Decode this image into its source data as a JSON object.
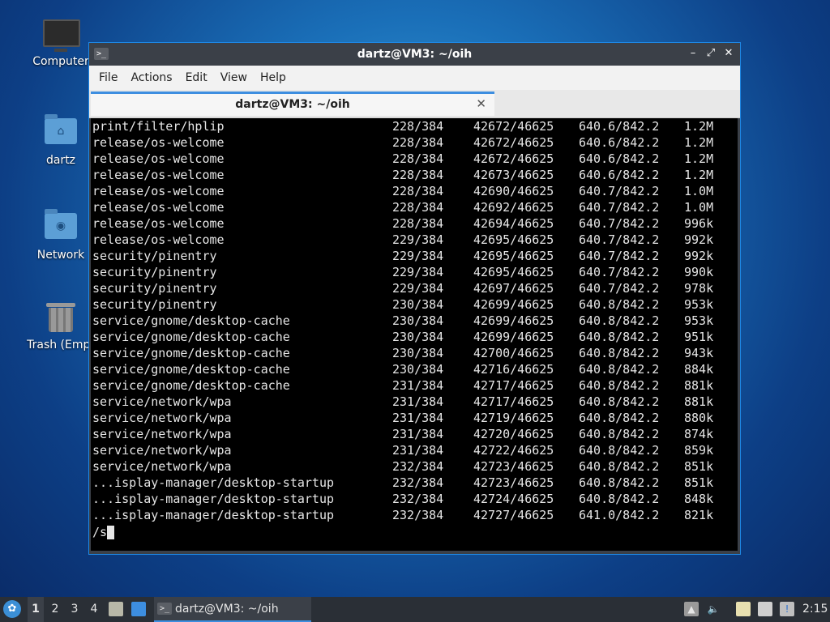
{
  "desktop": {
    "icons": [
      {
        "label": "Computer"
      },
      {
        "label": "dartz"
      },
      {
        "label": "Network"
      },
      {
        "label": "Trash (Empt"
      }
    ]
  },
  "window": {
    "title": "dartz@VM3: ~/oih",
    "controls": {
      "minimize": "–",
      "maximize": "⤢",
      "close": "✕"
    },
    "menu": [
      "File",
      "Actions",
      "Edit",
      "View",
      "Help"
    ],
    "tab": {
      "title": "dartz@VM3: ~/oih",
      "close": "✕"
    }
  },
  "terminal": {
    "rows": [
      [
        "print/filter/hplip",
        "228/384",
        "42672/46625",
        "640.6/842.2",
        "1.2M"
      ],
      [
        "release/os-welcome",
        "228/384",
        "42672/46625",
        "640.6/842.2",
        "1.2M"
      ],
      [
        "release/os-welcome",
        "228/384",
        "42672/46625",
        "640.6/842.2",
        "1.2M"
      ],
      [
        "release/os-welcome",
        "228/384",
        "42673/46625",
        "640.6/842.2",
        "1.2M"
      ],
      [
        "release/os-welcome",
        "228/384",
        "42690/46625",
        "640.7/842.2",
        "1.0M"
      ],
      [
        "release/os-welcome",
        "228/384",
        "42692/46625",
        "640.7/842.2",
        "1.0M"
      ],
      [
        "release/os-welcome",
        "228/384",
        "42694/46625",
        "640.7/842.2",
        "996k"
      ],
      [
        "release/os-welcome",
        "229/384",
        "42695/46625",
        "640.7/842.2",
        "992k"
      ],
      [
        "security/pinentry",
        "229/384",
        "42695/46625",
        "640.7/842.2",
        "992k"
      ],
      [
        "security/pinentry",
        "229/384",
        "42695/46625",
        "640.7/842.2",
        "990k"
      ],
      [
        "security/pinentry",
        "229/384",
        "42697/46625",
        "640.7/842.2",
        "978k"
      ],
      [
        "security/pinentry",
        "230/384",
        "42699/46625",
        "640.8/842.2",
        "953k"
      ],
      [
        "service/gnome/desktop-cache",
        "230/384",
        "42699/46625",
        "640.8/842.2",
        "953k"
      ],
      [
        "service/gnome/desktop-cache",
        "230/384",
        "42699/46625",
        "640.8/842.2",
        "951k"
      ],
      [
        "service/gnome/desktop-cache",
        "230/384",
        "42700/46625",
        "640.8/842.2",
        "943k"
      ],
      [
        "service/gnome/desktop-cache",
        "230/384",
        "42716/46625",
        "640.8/842.2",
        "884k"
      ],
      [
        "service/gnome/desktop-cache",
        "231/384",
        "42717/46625",
        "640.8/842.2",
        "881k"
      ],
      [
        "service/network/wpa",
        "231/384",
        "42717/46625",
        "640.8/842.2",
        "881k"
      ],
      [
        "service/network/wpa",
        "231/384",
        "42719/46625",
        "640.8/842.2",
        "880k"
      ],
      [
        "service/network/wpa",
        "231/384",
        "42720/46625",
        "640.8/842.2",
        "874k"
      ],
      [
        "service/network/wpa",
        "231/384",
        "42722/46625",
        "640.8/842.2",
        "859k"
      ],
      [
        "service/network/wpa",
        "232/384",
        "42723/46625",
        "640.8/842.2",
        "851k"
      ],
      [
        "...isplay-manager/desktop-startup",
        "232/384",
        "42723/46625",
        "640.8/842.2",
        "851k"
      ],
      [
        "...isplay-manager/desktop-startup",
        "232/384",
        "42724/46625",
        "640.8/842.2",
        "848k"
      ],
      [
        "...isplay-manager/desktop-startup",
        "232/384",
        "42727/46625",
        "641.0/842.2",
        "821k"
      ]
    ],
    "prompt": "/s"
  },
  "taskbar": {
    "workspaces": [
      "1",
      "2",
      "3",
      "4"
    ],
    "task_label": "dartz@VM3: ~/oih",
    "clock": "2:15"
  }
}
